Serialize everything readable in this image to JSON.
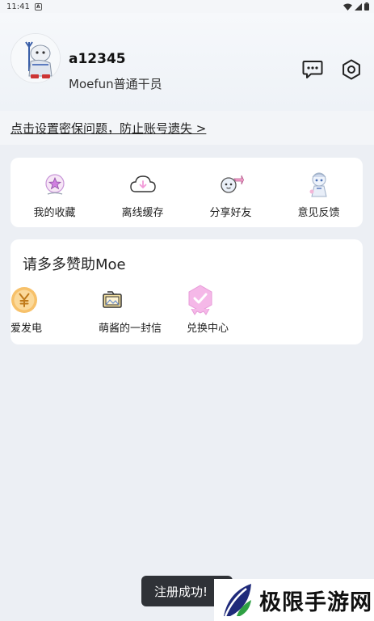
{
  "status_bar": {
    "time": "11:41",
    "app_icon_letter": "A"
  },
  "profile": {
    "username": "a12345",
    "role": "Moefun普通干员"
  },
  "notice": {
    "text": "点击设置密保问题，防止账号遗失 >"
  },
  "shortcuts": [
    {
      "label": "我的收藏",
      "icon": "favorites-icon"
    },
    {
      "label": "离线缓存",
      "icon": "offline-cache-icon"
    },
    {
      "label": "分享好友",
      "icon": "share-icon"
    },
    {
      "label": "意见反馈",
      "icon": "feedback-icon"
    }
  ],
  "sponsor": {
    "title": "请多多赞助Moe",
    "items": [
      {
        "label": "爱发电",
        "icon": "yen-coin-icon"
      },
      {
        "label": "萌酱的一封信",
        "icon": "letter-icon"
      },
      {
        "label": "兑换中心",
        "icon": "redeem-badge-icon"
      }
    ]
  },
  "toast": {
    "text": "注册成功!"
  },
  "watermark": {
    "text": "极限手游网"
  },
  "colors": {
    "background": "#eceff4",
    "card": "#ffffff",
    "toast_bg": "#2f3237",
    "accent_pink": "#f5b8e8",
    "accent_yellow": "#f7c16a"
  }
}
